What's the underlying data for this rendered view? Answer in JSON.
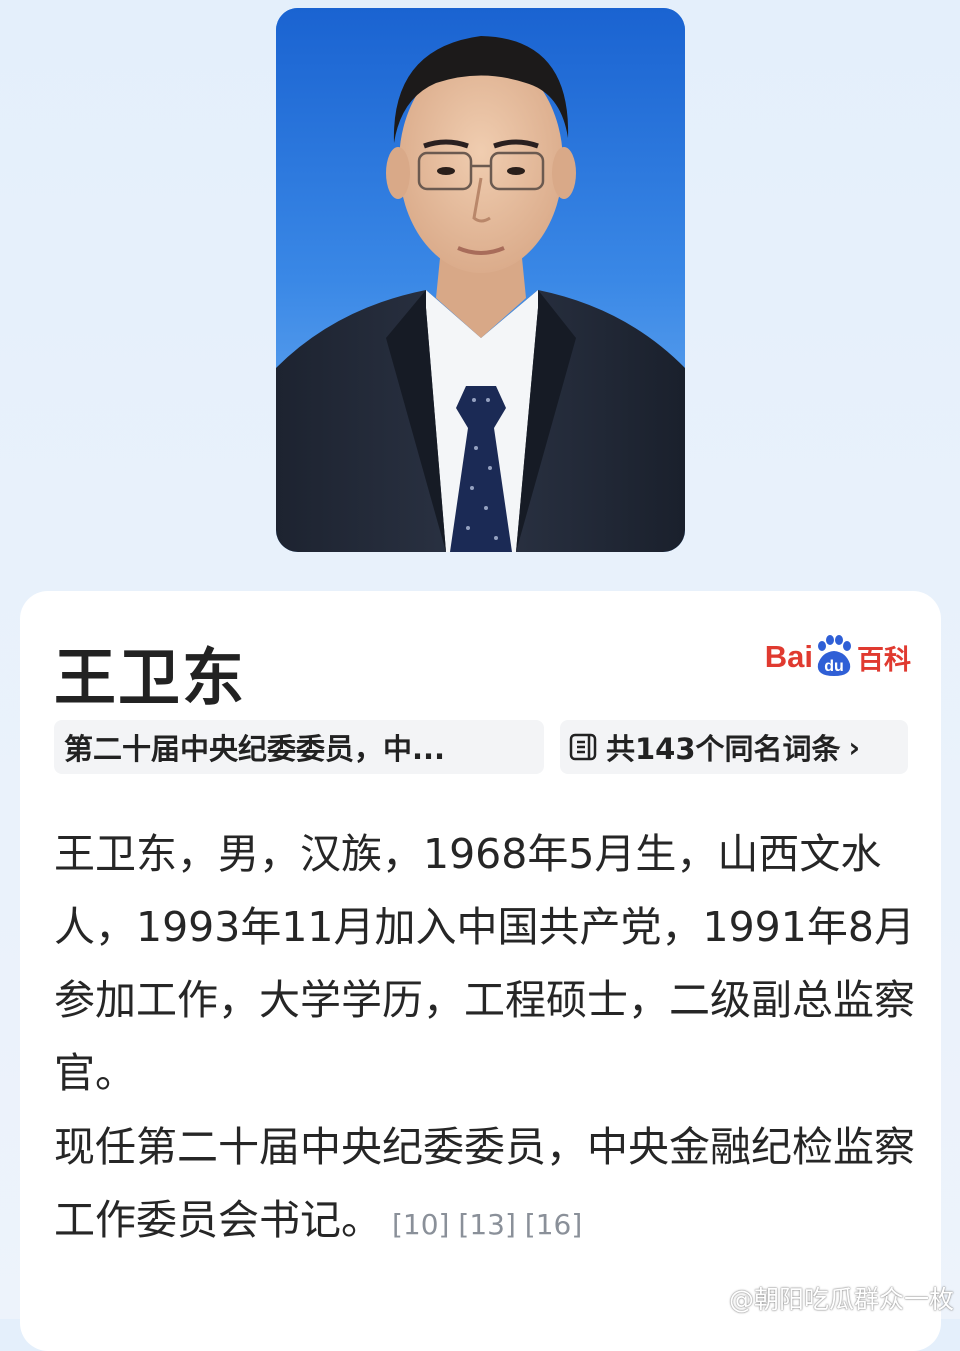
{
  "profile": {
    "name": "王卫东",
    "brand": {
      "part1": "Bai",
      "part2": "du",
      "part3": "百科",
      "color": "#e03a30"
    }
  },
  "chips": {
    "summary": "第二十届中央纪委委员，中...",
    "homonyms": "共143个同名词条",
    "homonyms_icon": "list-icon",
    "chevron": "›"
  },
  "body": {
    "paragraph1": "王卫东，男，汉族，1968年5月生，山西文水人，1993年11月加入中国共产党，1991年8月参加工作，大学学历，工程硕士，二级副总监察官。",
    "paragraph2": "现任第二十届中央纪委委员，中央金融纪检监察工作委员会书记。",
    "refs": [
      "[10]",
      "[13]",
      "[16]"
    ]
  },
  "watermark": {
    "text": "@朝阳吃瓜群众一枚",
    "icon": "weibo-icon"
  }
}
